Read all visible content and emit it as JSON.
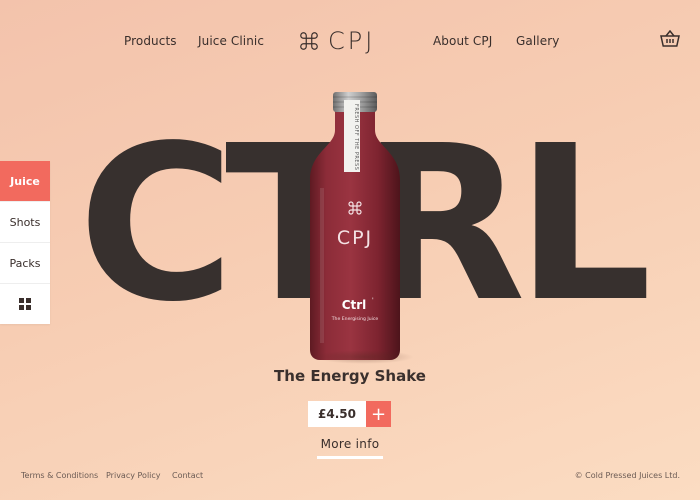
{
  "nav": {
    "left": [
      "Products",
      "Juice Clinic"
    ],
    "right": [
      "About CPJ",
      "Gallery"
    ],
    "logo_text": "CPJ",
    "logo_icon": "command-icon",
    "cart_icon": "basket-icon"
  },
  "hero": {
    "big_word": "CTRL",
    "product_title": "The Energy Shake",
    "price": "£4.50",
    "add_label": "+",
    "more_info": "More info"
  },
  "bottle": {
    "cap_band": "FRESH OFF THE PRESS",
    "brand": "CPJ",
    "name": "Ctrl",
    "name_mark": "'",
    "tagline": "The Energising Juice"
  },
  "side_menu": {
    "items": [
      "Juice",
      "Shots",
      "Packs"
    ],
    "active": "Juice",
    "grid_icon": "grid-icon"
  },
  "footer": {
    "links": [
      "Terms & Conditions",
      "Privacy Policy",
      "Contact"
    ],
    "copyright": "© Cold Pressed Juices Ltd."
  },
  "colors": {
    "accent": "#f26a5e",
    "text_dark": "#37302e",
    "background": "#f7cdb3",
    "bottle": "#8a2a36"
  }
}
